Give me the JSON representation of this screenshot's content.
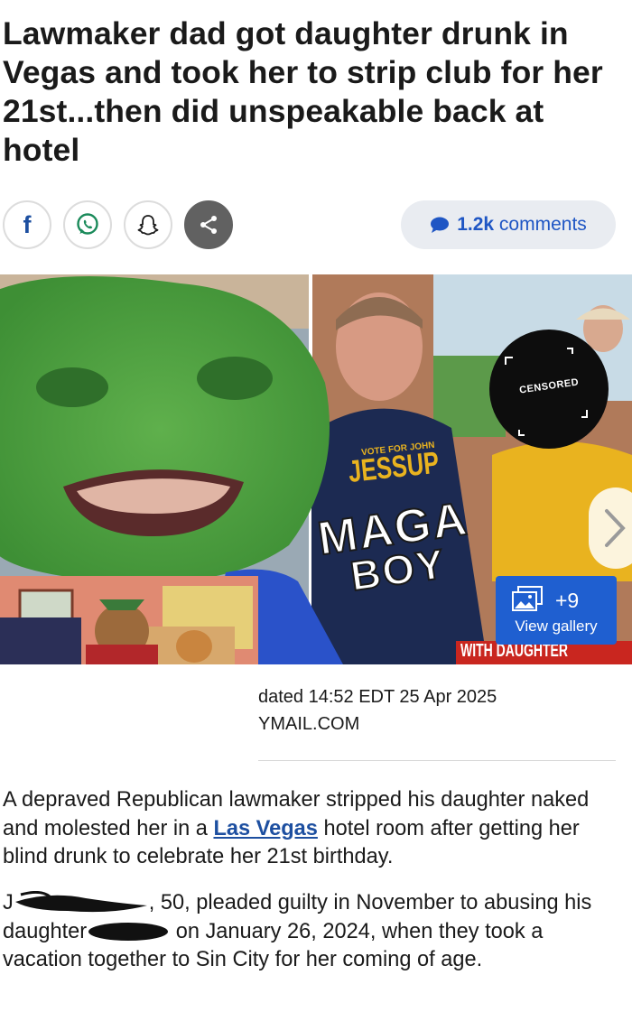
{
  "article": {
    "headline": "Lawmaker dad got daughter drunk in Vegas and took her to strip club for her 21st...then did unspeakable back at hotel",
    "byline_date": "dated 14:52 EDT 25 Apr 2025",
    "byline_source": "YMAIL.COM"
  },
  "share": {
    "facebook_label": "f",
    "comments_count": "1.2k",
    "comments_label": "comments"
  },
  "hero": {
    "shirt_small": "VOTE FOR JOHN",
    "shirt_name": "JESSUP",
    "overlay_line1": "MAGA",
    "overlay_line2": "BOY",
    "sticker_text": "CENSORED",
    "caption_strip": "WITH DAUGHTER",
    "gallery_count": "+9",
    "gallery_label": "View gallery"
  },
  "paragraphs": {
    "p1_before": "A depraved Republican lawmaker stripped his daughter naked and molested her in a ",
    "p1_link": "Las Vegas",
    "p1_after": " hotel room after getting her blind drunk to celebrate her 21st birthday.",
    "p2_start": "J",
    "p2_a": ", 50, pleaded guilty in November to abusing his daughter",
    "p2_b": " on January 26, 2024, when they took a vacation together to Sin City for her coming of age."
  },
  "colors": {
    "headline": "#1a1a1a",
    "link": "#1d4fa0",
    "comments_accent": "#1f56c4",
    "gallery_button": "#1f5fd0",
    "pill_bg": "#e9ecf1"
  },
  "icons": [
    "facebook-icon",
    "whatsapp-icon",
    "snapchat-icon",
    "share-icon",
    "comment-bubble-icon",
    "gallery-icon",
    "chevron-right-icon"
  ]
}
